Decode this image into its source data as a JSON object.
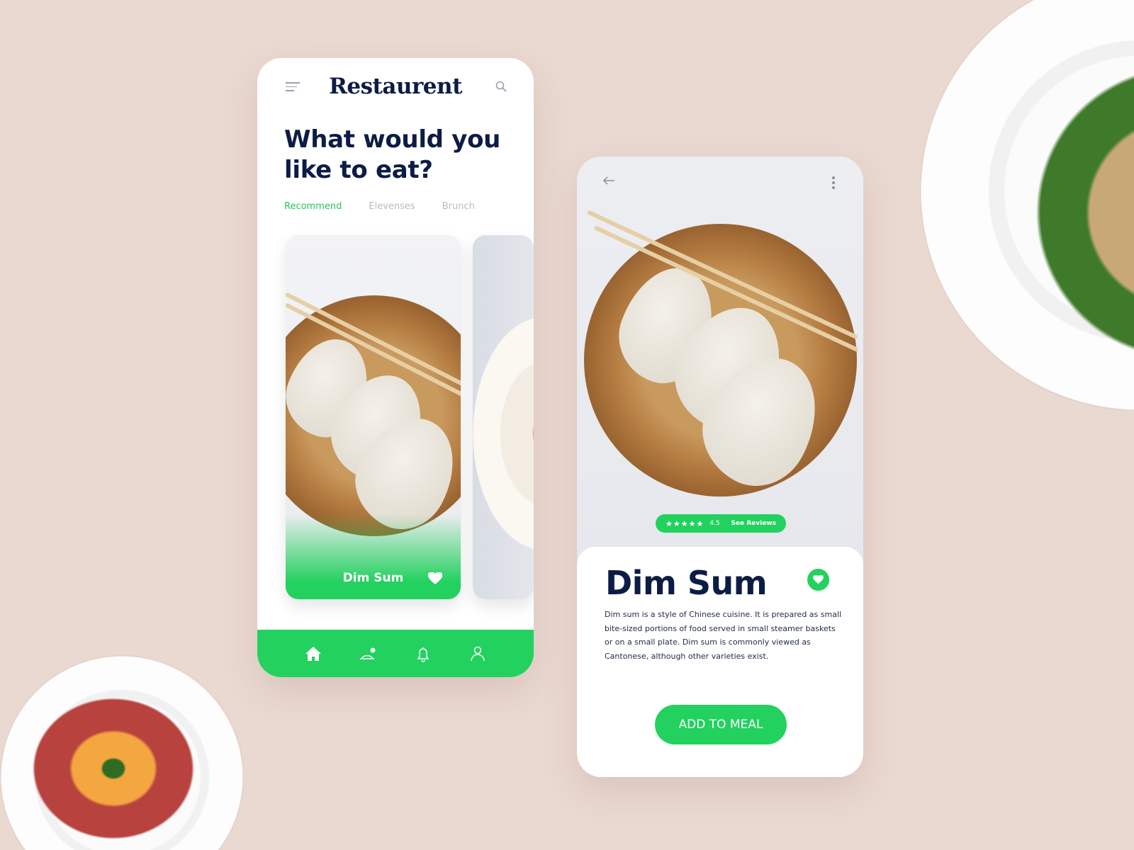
{
  "colors": {
    "accent": "#22d15e",
    "navy": "#0d1c45",
    "background": "#ead9d1"
  },
  "home": {
    "logo": "Restaurent",
    "headline_line1": "What would you",
    "headline_line2": "like to eat?",
    "tabs": [
      {
        "label": "Recommend",
        "active": true
      },
      {
        "label": "Elevenses",
        "active": false
      },
      {
        "label": "Brunch",
        "active": false
      }
    ],
    "cards": [
      {
        "title": "Dim Sum",
        "favorited": true
      }
    ],
    "nav": [
      "home-icon",
      "dish-cover-icon",
      "bell-icon",
      "user-icon"
    ]
  },
  "detail": {
    "rating_stars": "★★★★★",
    "rating": "4.5",
    "see_reviews": "See Reviews",
    "title": "Dim Sum",
    "favorited": true,
    "description": "Dim sum is a style of Chinese cuisine. It is prepared as small bite-sized portions of food served in small steamer baskets or on a small plate. Dim sum is commonly viewed as Cantonese, although other varieties exist.",
    "add_button": "ADD TO MEAL"
  }
}
